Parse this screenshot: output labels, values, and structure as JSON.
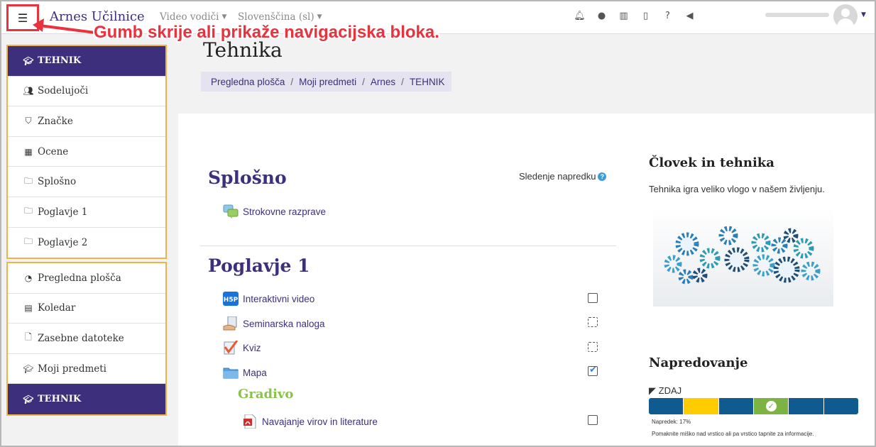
{
  "navbar": {
    "menu_toggle_icon": "hamburger-icon",
    "brand": "Arnes Učilnice",
    "menus": [
      {
        "label": "Video vodiči"
      },
      {
        "label": "Slovenščina (sl)"
      }
    ],
    "icons": [
      "bell-icon",
      "chat-icon",
      "book-icon",
      "mobile-icon",
      "help-icon",
      "megaphone-icon"
    ]
  },
  "callout": {
    "text": "Gumb skrije ali prikaže navigacijska bloka.",
    "color": "#e8323d"
  },
  "sidebar": {
    "block1": [
      {
        "label": "TEHNIK",
        "icon": "graduation-cap-icon",
        "active": true
      },
      {
        "label": "Sodelujoči",
        "icon": "users-icon"
      },
      {
        "label": "Značke",
        "icon": "shield-icon"
      },
      {
        "label": "Ocene",
        "icon": "table-icon"
      },
      {
        "label": "Splošno",
        "icon": "folder-icon"
      },
      {
        "label": "Poglavje 1",
        "icon": "folder-icon"
      },
      {
        "label": "Poglavje 2",
        "icon": "folder-icon"
      }
    ],
    "block2": [
      {
        "label": "Pregledna plošča",
        "icon": "dashboard-icon"
      },
      {
        "label": "Koledar",
        "icon": "calendar-icon"
      },
      {
        "label": "Zasebne datoteke",
        "icon": "file-icon"
      },
      {
        "label": "Moji predmeti",
        "icon": "graduation-cap-icon"
      },
      {
        "label": "TEHNIK",
        "icon": "graduation-cap-icon",
        "active": true
      }
    ]
  },
  "page": {
    "title": "Tehnika",
    "breadcrumb": [
      "Pregledna plošča",
      "Moji predmeti",
      "Arnes",
      "TEHNIK"
    ]
  },
  "course": {
    "progress_help": "Sledenje napredku",
    "sections": [
      {
        "title": "Splošno",
        "activities": [
          {
            "label": "Strokovne razprave",
            "icon": "forum-icon"
          }
        ]
      },
      {
        "title": "Poglavje 1",
        "activities": [
          {
            "label": "Interaktivni video",
            "icon": "h5p-icon",
            "completion": "manual-incomplete"
          },
          {
            "label": "Seminarska naloga",
            "icon": "assignment-icon",
            "completion": "auto-incomplete"
          },
          {
            "label": "Kviz",
            "icon": "quiz-icon",
            "completion": "auto-incomplete"
          },
          {
            "label": "Mapa",
            "icon": "folder-icon",
            "completion": "manual-complete"
          }
        ],
        "subheading": "Gradivo",
        "sub_activities": [
          {
            "label": "Navajanje virov in literature",
            "icon": "pdf-icon",
            "completion": "manual-incomplete"
          }
        ]
      }
    ]
  },
  "right_column": {
    "course_block": {
      "title": "Človek in tehnika",
      "text": "Tehnika igra veliko vlogo v našem življenju.",
      "image": "gears-illustration"
    },
    "progress_block": {
      "title": "Napredovanje",
      "state_label": "ZDAJ",
      "segments": [
        "#0f5a8e",
        "#ffcc00",
        "#0f5a8e",
        "#7cb342",
        "#0f5a8e",
        "#0f5a8e"
      ],
      "completed_segment": 3,
      "progress_text": "Napredek: 17%",
      "hint": "Pomaknite miško nad vrstico ali pa vrstico tapnite za informacije."
    }
  },
  "colors": {
    "primary": "#3d2f7c",
    "highlight_border": "#f2b244",
    "annotation": "#e8323d"
  }
}
